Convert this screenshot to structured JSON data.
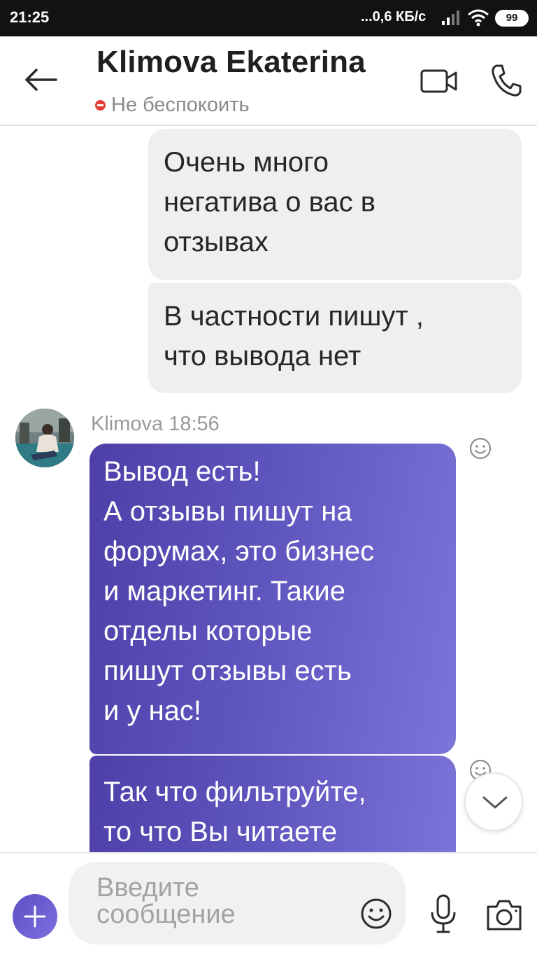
{
  "status_bar": {
    "time": "21:25",
    "network_speed": "...0,6 КБ/с",
    "battery": "99"
  },
  "header": {
    "contact_name": "Klimova Ekaterina",
    "presence": "Не беспокоить",
    "presence_color": "#e53935"
  },
  "messages": {
    "outgoing_1": "Очень много\nнегатива о вас в\nотзывах",
    "outgoing_2": "В частности пишут ,\nчто вывода нет",
    "sender_meta": "Klimova 18:56",
    "incoming_1": "Вывод есть!\nА отзывы пишут на\nфорумах, это бизнес\nи маркетинг. Такие\nотделы которые\nпишут отзывы есть\nи у нас!",
    "incoming_2": "Так что фильтруйте,\nто что Вы читаете"
  },
  "composer": {
    "placeholder": "Введите\nсообщение"
  },
  "colors": {
    "accent": "#5d55bd",
    "incoming_gradient_start": "#4e3fa8",
    "incoming_gradient_end": "#7c74d8",
    "outgoing_bubble": "#efefef"
  },
  "icons": {
    "back": "arrow-left-icon",
    "video": "video-camera-icon",
    "call": "phone-icon",
    "reaction": "smiley-icon",
    "scroll": "chevron-down-icon",
    "attach": "plus-icon",
    "emoji": "emoji-icon",
    "mic": "microphone-icon",
    "camera": "camera-icon"
  }
}
